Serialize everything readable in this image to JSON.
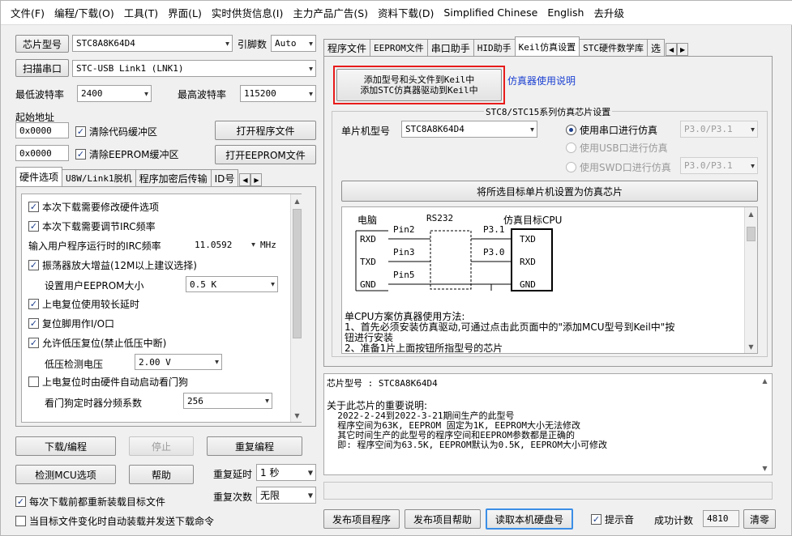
{
  "menu": [
    "文件(F)",
    "编程/下载(O)",
    "工具(T)",
    "界面(L)",
    "实时供货信息(I)",
    "主力产品广告(S)",
    "资料下载(D)",
    "Simplified Chinese",
    "English",
    "去升级"
  ],
  "left": {
    "chip_btn": "芯片型号",
    "chip_value": "STC8A8K64D4",
    "pins_label": "引脚数",
    "pins_value": "Auto",
    "scan_btn": "扫描串口",
    "port_value": "STC-USB Link1 (LNK1)",
    "min_baud_label": "最低波特率",
    "min_baud_value": "2400",
    "max_baud_label": "最高波特率",
    "max_baud_value": "115200",
    "start_addr_label": "起始地址",
    "addr1": "0x0000",
    "clear_code": "清除代码缓冲区",
    "open_prog": "打开程序文件",
    "addr2": "0x0000",
    "clear_eeprom": "清除EEPROM缓冲区",
    "open_eeprom": "打开EEPROM文件",
    "tabs": [
      "硬件选项",
      "U8W/Link1脱机",
      "程序加密后传输",
      "ID号"
    ],
    "options": {
      "o1": "本次下载需要修改硬件选项",
      "o2": "本次下载需要调节IRC频率",
      "irc_label": "输入用户程序运行时的IRC频率",
      "irc_value": "11.0592",
      "irc_unit": "MHz",
      "o3": "振荡器放大增益(12M以上建议选择)",
      "eeprom_label": "设置用户EEPROM大小",
      "eeprom_value": "0.5 K",
      "o4": "上电复位使用较长延时",
      "o5": "复位脚用作I/O口",
      "o6": "允许低压复位(禁止低压中断)",
      "lv_label": "低压检测电压",
      "lv_value": "2.00 V",
      "o7": "上电复位时由硬件自动启动看门狗",
      "wdt_label": "看门狗定时器分频系数",
      "wdt_value": "256"
    },
    "download_btn": "下载/编程",
    "stop_btn": "停止",
    "reprog_btn": "重复编程",
    "detect_btn": "检测MCU选项",
    "help_btn": "帮助",
    "delay_label": "重复延时",
    "delay_value": "1 秒",
    "count_label": "重复次数",
    "count_value": "无限",
    "reload_cb": "每次下载前都重新装载目标文件",
    "auto_cb": "当目标文件变化时自动装载并发送下载命令"
  },
  "right": {
    "tabs": [
      "程序文件",
      "EEPROM文件",
      "串口助手",
      "HID助手",
      "Keil仿真设置",
      "STC硬件数学库",
      "选"
    ],
    "add_btn_line1": "添加型号和头文件到Keil中",
    "add_btn_line2": "添加STC仿真器驱动到Keil中",
    "emu_link": "仿真器使用说明",
    "group_title": "STC8/STC15系列仿真芯片设置",
    "mcu_label": "单片机型号",
    "mcu_value": "STC8A8K64D4",
    "r1": "使用串口进行仿真",
    "r1_value": "P3.0/P3.1",
    "r2": "使用USB口进行仿真",
    "r3": "使用SWD口进行仿真",
    "r3_value": "P3.0/P3.1",
    "set_btn": "将所选目标单片机设置为仿真芯片",
    "diagram": {
      "pc": "电脑",
      "rs232": "RS232",
      "target": "仿真目标CPU",
      "rxd": "RXD",
      "txd": "TXD",
      "gnd": "GND",
      "pin2": "Pin2",
      "pin3": "Pin3",
      "pin5": "Pin5",
      "p31": "P3.1",
      "p30": "P3.0",
      "ttxd": "TXD",
      "trxd": "RXD",
      "tgnd": "GND"
    },
    "instr_title": "单CPU方案仿真器使用方法:",
    "instr1": "1、首先必须安装仿真驱动,可通过点击此页面中的\"添加MCU型号到Keil中\"按",
    "instr1b": "钮进行安装",
    "instr2": "2、准备1片上面按钮所指型号的芯片",
    "info_chip": "芯片型号 : STC8A8K64D4",
    "info_title": "关于此芯片的重要说明:",
    "info1": "  2022-2-24到2022-3-21期间生产的此型号",
    "info2": "  程序空间为63K, EEPROM 固定为1K, EEPROM大小无法修改",
    "info3": "  其它时间生产的此型号的程序空间和EEPROM参数都是正确的",
    "info4": "  即: 程序空间为63.5K, EEPROM默认为0.5K, EEPROM大小可修改",
    "pub_prog": "发布项目程序",
    "pub_help": "发布项目帮助",
    "read_hdd": "读取本机硬盘号",
    "beep_cb": "提示音",
    "success_label": "成功计数",
    "success_value": "4810",
    "clear_btn": "清零"
  }
}
